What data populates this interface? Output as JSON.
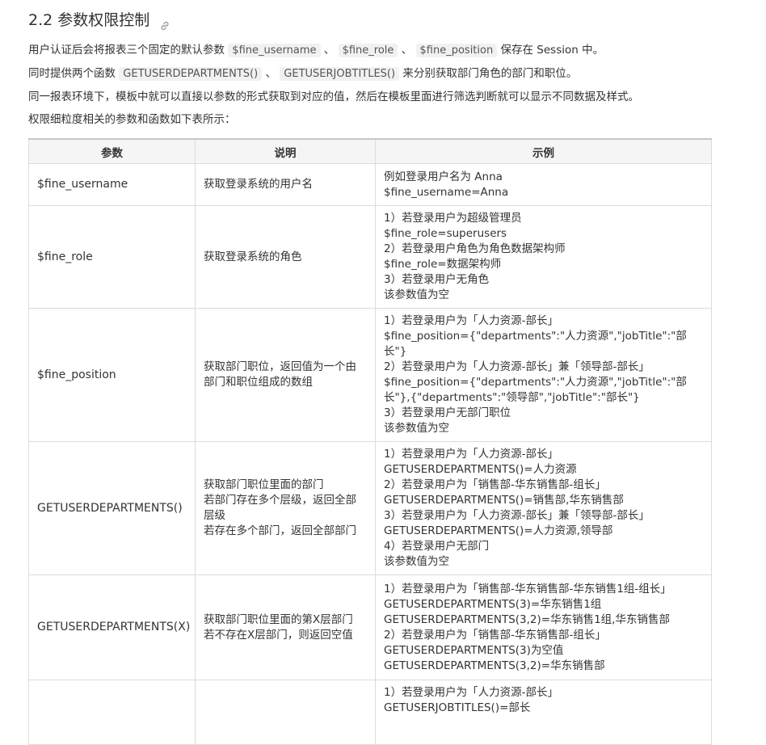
{
  "heading": {
    "title": "2.2 参数权限控制",
    "link_icon": "link-icon"
  },
  "paragraphs": {
    "p1": {
      "before": "用户认证后会将报表三个固定的默认参数",
      "code1": "$fine_username",
      "sep1": "、",
      "code2": "$fine_role",
      "sep2": "、",
      "code3": "$fine_position",
      "after": "保存在 Session 中。"
    },
    "p2": {
      "before": "同时提供两个函数",
      "code1": "GETUSERDEPARTMENTS()",
      "sep1": "、",
      "code2": "GETUSERJOBTITLES()",
      "after": "来分别获取部门角色的部门和职位。"
    },
    "p3": "同一报表环境下，模板中就可以直接以参数的形式获取到对应的值，然后在模板里面进行筛选判断就可以显示不同数据及样式。",
    "p4": "权限细粒度相关的参数和函数如下表所示："
  },
  "table": {
    "headers": [
      "参数",
      "说明",
      "示例"
    ],
    "rows": [
      {
        "param": "$fine_username",
        "desc": [
          "获取登录系统的用户名"
        ],
        "example": [
          "例如登录用户名为 Anna",
          "$fine_username=Anna"
        ]
      },
      {
        "param": "$fine_role",
        "desc": [
          "获取登录系统的角色"
        ],
        "example": [
          "1）若登录用户为超级管理员",
          "$fine_role=superusers",
          "2）若登录用户角色为角色数据架构师",
          "$fine_role=数据架构师",
          "3）若登录用户无角色",
          "该参数值为空"
        ]
      },
      {
        "param": "$fine_position",
        "desc": [
          "获取部门职位，返回值为一个由部门和职位组成的数组"
        ],
        "example": [
          "1）若登录用户为「人力资源-部长」",
          "$fine_position={\"departments\":\"人力资源\",\"jobTitle\":\"部长\"}",
          "2）若登录用户为「人力资源-部长」兼「领导部-部长」",
          "$fine_position={\"departments\":\"人力资源\",\"jobTitle\":\"部长\"},{\"departments\":\"领导部\",\"jobTitle\":\"部长\"}",
          "3）若登录用户无部门职位",
          "该参数值为空"
        ]
      },
      {
        "param": "GETUSERDEPARTMENTS()",
        "desc": [
          "获取部门职位里面的部门",
          "若部门存在多个层级，返回全部层级",
          "若存在多个部门，返回全部部门"
        ],
        "example": [
          "1）若登录用户为「人力资源-部长」",
          "GETUSERDEPARTMENTS()=人力资源",
          "2）若登录用户为「销售部-华东销售部-组长」",
          "GETUSERDEPARTMENTS()=销售部,华东销售部",
          "3）若登录用户为「人力资源-部长」兼「领导部-部长」",
          "GETUSERDEPARTMENTS()=人力资源,领导部",
          "4）若登录用户无部门",
          "该参数值为空"
        ]
      },
      {
        "param": "GETUSERDEPARTMENTS(X)",
        "desc": [
          "获取部门职位里面的第X层部门",
          "若不存在X层部门，则返回空值"
        ],
        "example": [
          "1）若登录用户为「销售部-华东销售部-华东销售1组-组长」",
          "GETUSERDEPARTMENTS(3)=华东销售1组",
          "GETUSERDEPARTMENTS(3,2)=华东销售1组,华东销售部",
          "2）若登录用户为「销售部-华东销售部-组长」",
          "GETUSERDEPARTMENTS(3)为空值",
          "GETUSERDEPARTMENTS(3,2)=华东销售部"
        ]
      },
      {
        "param": "",
        "desc": [],
        "example": [
          "1）若登录用户为「人力资源-部长」",
          "GETUSERJOBTITLES()=部长"
        ]
      }
    ]
  }
}
